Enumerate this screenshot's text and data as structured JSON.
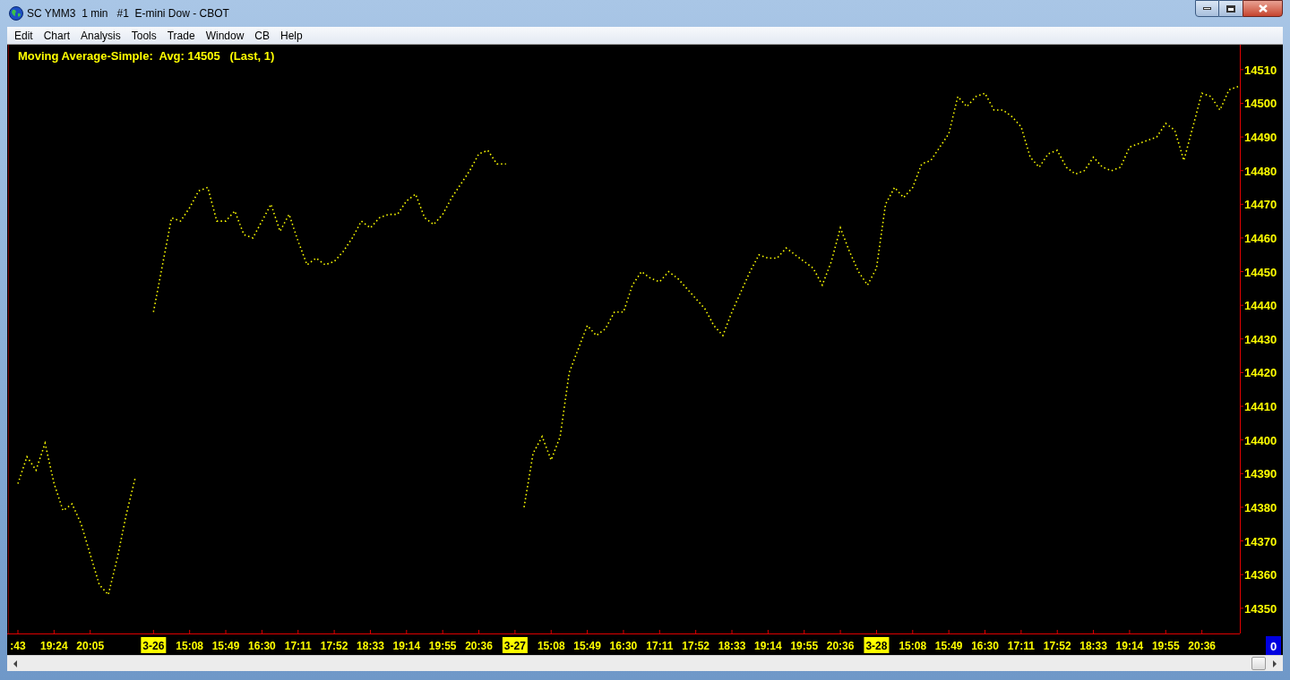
{
  "window": {
    "title": "SC YMM3  1 min   #1  E-mini Dow - CBOT"
  },
  "menu": [
    "Edit",
    "Chart",
    "Analysis",
    "Tools",
    "Trade",
    "Window",
    "CB",
    "Help"
  ],
  "chart": {
    "chart_data": {
      "type": "line",
      "title": "Moving Average-Simple:  Avg: 14505   (Last, 1)",
      "categories": [
        ":43",
        null,
        null,
        null,
        "19:24",
        null,
        null,
        null,
        "20:05",
        null,
        null,
        null,
        null,
        null,
        null,
        "3-26",
        null,
        null,
        null,
        "15:08",
        null,
        null,
        null,
        "15:49",
        null,
        null,
        null,
        "16:30",
        null,
        null,
        null,
        "17:11",
        null,
        null,
        null,
        "17:52",
        null,
        null,
        null,
        "18:33",
        null,
        null,
        null,
        "19:14",
        null,
        null,
        null,
        "19:55",
        null,
        null,
        null,
        "20:36",
        null,
        null,
        null,
        "3-27",
        null,
        null,
        null,
        "15:08",
        null,
        null,
        null,
        "15:49",
        null,
        null,
        null,
        "16:30",
        null,
        null,
        null,
        "17:11",
        null,
        null,
        null,
        "17:52",
        null,
        null,
        null,
        "18:33",
        null,
        null,
        null,
        "19:14",
        null,
        null,
        null,
        "19:55",
        null,
        null,
        null,
        "20:36",
        null,
        null,
        null,
        "3-28",
        null,
        null,
        null,
        "15:08",
        null,
        null,
        null,
        "15:49",
        null,
        null,
        null,
        "16:30",
        null,
        null,
        null,
        "17:11",
        null,
        null,
        null,
        "17:52",
        null,
        null,
        null,
        "18:33",
        null,
        null,
        null,
        "19:14",
        null,
        null,
        null,
        "19:55",
        null,
        null,
        null,
        "20:36",
        null,
        null,
        null,
        null
      ],
      "series": [
        {
          "color": "#ffff00",
          "line_style": "dotted",
          "values": [
            14387,
            14395,
            14391,
            14399,
            14387,
            14379,
            14381,
            14375,
            14366,
            14357,
            14354,
            14365,
            14378,
            14389,
            null,
            14438,
            14452,
            14466,
            14465,
            14469,
            14474,
            14475,
            14465,
            14465,
            14468,
            14461,
            14460,
            14465,
            14470,
            14462,
            14467,
            14459,
            14452,
            14454,
            14452,
            14453,
            14456,
            14460,
            14465,
            14463,
            14466,
            14467,
            14467,
            14471,
            14473,
            14466,
            14464,
            14467,
            14472,
            14476,
            14480,
            14485,
            14486,
            14482,
            14482,
            null,
            14380,
            14396,
            14401,
            14394,
            14401,
            14420,
            14427,
            14434,
            14431,
            14433,
            14438,
            14438,
            14446,
            14450,
            14448,
            14447,
            14450,
            14448,
            14445,
            14442,
            14439,
            14434,
            14431,
            14438,
            14444,
            14450,
            14455,
            14454,
            14454,
            14457,
            14455,
            14453,
            14451,
            14446,
            14453,
            14463,
            14456,
            14450,
            14446,
            14451,
            14470,
            14475,
            14472,
            14475,
            14482,
            14483,
            14487,
            14491,
            14502,
            14499,
            14502,
            14503,
            14498,
            14498,
            14496,
            14493,
            14484,
            14481,
            14485,
            14486,
            14481,
            14479,
            14480,
            14484,
            14481,
            14480,
            14481,
            14487,
            14488,
            14489,
            14490,
            14494,
            14492,
            14483,
            14493,
            14503,
            14502,
            14498,
            14504,
            14505
          ]
        }
      ],
      "ylim": [
        14342.5,
        14517.4
      ],
      "yticks": [
        14350,
        14360,
        14370,
        14380,
        14390,
        14400,
        14410,
        14420,
        14430,
        14440,
        14450,
        14460,
        14470,
        14480,
        14490,
        14500,
        14510
      ]
    },
    "x_label_highlighted": [
      false,
      false,
      false,
      true,
      false,
      false,
      false,
      false,
      false,
      false,
      false,
      false,
      false,
      true,
      false,
      false,
      false,
      false,
      false,
      false,
      false,
      false,
      false,
      true,
      false,
      false,
      false,
      false,
      false,
      false,
      false,
      false,
      false
    ],
    "counter": "0"
  }
}
